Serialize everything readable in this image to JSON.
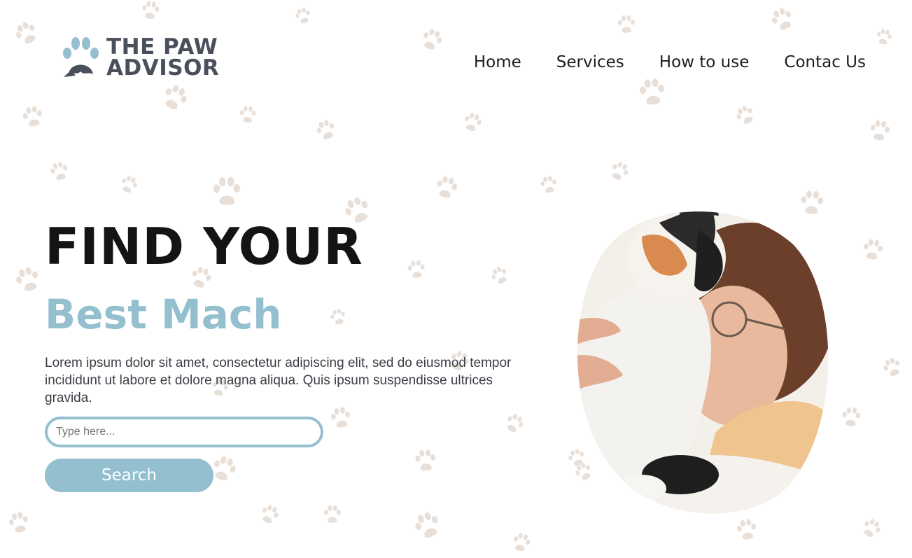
{
  "brand": {
    "name_line1": "THE PAW",
    "name_line2": "ADVISOR",
    "accent_color": "#93bfcf",
    "text_color": "#4a4f5c"
  },
  "nav": {
    "items": [
      {
        "label": "Home"
      },
      {
        "label": "Services"
      },
      {
        "label": "How to use"
      },
      {
        "label": "Contac Us"
      }
    ]
  },
  "hero": {
    "title": "FIND YOUR",
    "subtitle": "Best Mach",
    "description": "Lorem ipsum dolor sit amet, consectetur adipiscing elit, sed do eiusmod tempor incididunt ut labore et dolore magna aliqua. Quis ipsum suspendisse ultrices gravida.",
    "search": {
      "placeholder": "Type here...",
      "value": "",
      "button_label": "Search"
    }
  },
  "background": {
    "pattern_icon": "paw-print-icon",
    "pattern_color": "#e8dfd8"
  },
  "image": {
    "subject": "photo-woman-with-cat"
  }
}
